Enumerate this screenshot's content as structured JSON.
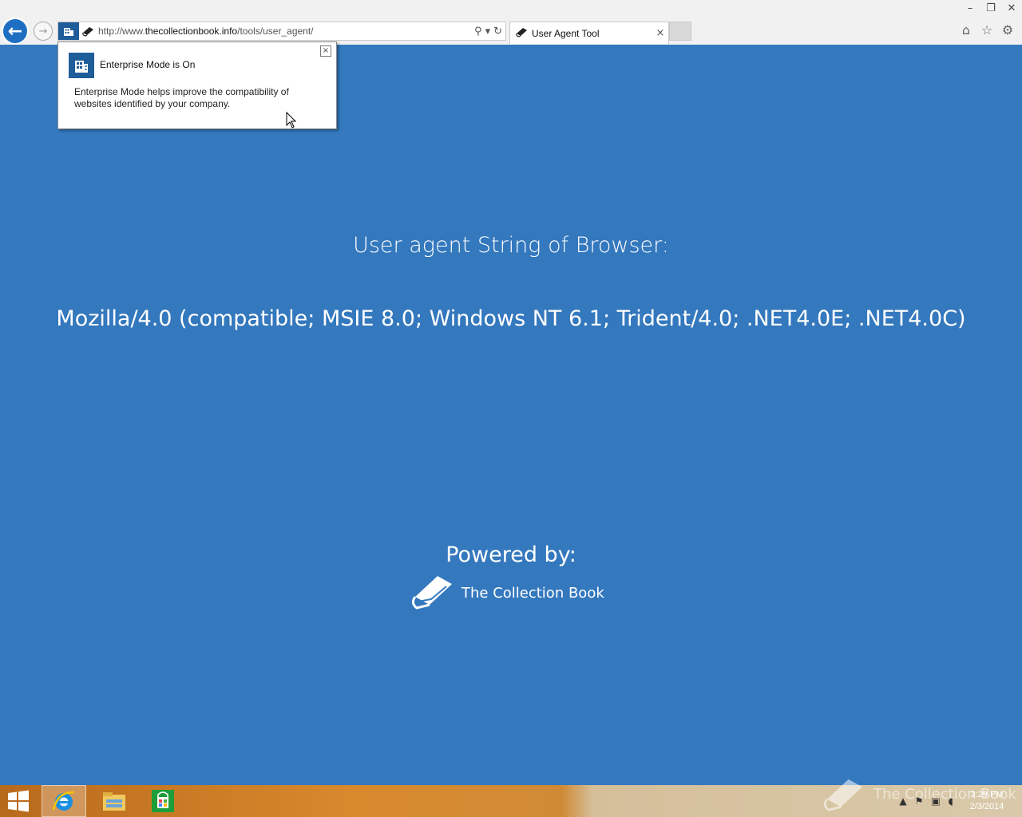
{
  "browser": {
    "url_prefix": "http://www.",
    "url_host": "thecollectionbook.info",
    "url_path": "/tools/user_agent/",
    "tab_title": "User Agent Tool",
    "tab_close": "×",
    "win_minimize": "–",
    "win_restore": "❐",
    "win_close": "✕"
  },
  "popup": {
    "title": "Enterprise Mode is On",
    "body": "Enterprise Mode helps improve the compatibility of websites identified by your company.",
    "close": "×"
  },
  "page": {
    "heading": "User agent String of Browser:",
    "user_agent": "Mozilla/4.0 (compatible; MSIE 8.0; Windows NT 6.1; Trident/4.0; .NET4.0E; .NET4.0C)",
    "powered_by": "Powered by:",
    "brand": "The Collection Book"
  },
  "taskbar": {
    "watermark": "The Collection Book",
    "time": "3:29 PM",
    "date": "2/3/2014"
  },
  "colors": {
    "page_bg": "#3478be",
    "accent": "#1e6fc1"
  }
}
